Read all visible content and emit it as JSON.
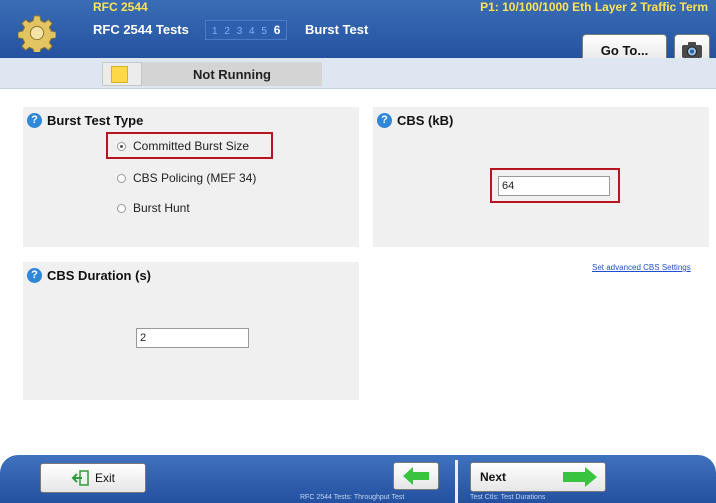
{
  "header": {
    "app_title": "RFC 2544",
    "port_info": "P1: 10/100/1000 Eth Layer 2 Traffic Term",
    "sub_title": "RFC 2544 Tests",
    "steps": [
      "1",
      "2",
      "3",
      "4",
      "5",
      "6"
    ],
    "active_step": "6",
    "test_name": "Burst Test",
    "goto_label": "Go To..."
  },
  "status": {
    "text": "Not Running",
    "indicator_color": "#ffd94a"
  },
  "burst_test_type": {
    "title": "Burst Test Type",
    "options": [
      "Committed Burst Size",
      "CBS Policing (MEF 34)",
      "Burst Hunt"
    ],
    "selected": "Committed Burst Size"
  },
  "cbs": {
    "title": "CBS (kB)",
    "value": "64"
  },
  "cbs_duration": {
    "title": "CBS Duration (s)",
    "value": "2"
  },
  "advanced_link": "Set advanced CBS Settings",
  "footer": {
    "exit_label": "Exit",
    "next_label": "Next",
    "prev_caption": "RFC 2544 Tests: Throughput Test",
    "next_caption": "Test Ctls: Test Durations"
  },
  "colors": {
    "header_blue": "#2552a0",
    "accent_yellow": "#ffe34f",
    "highlight_red": "#b8141f",
    "arrow_green": "#39c43f"
  }
}
